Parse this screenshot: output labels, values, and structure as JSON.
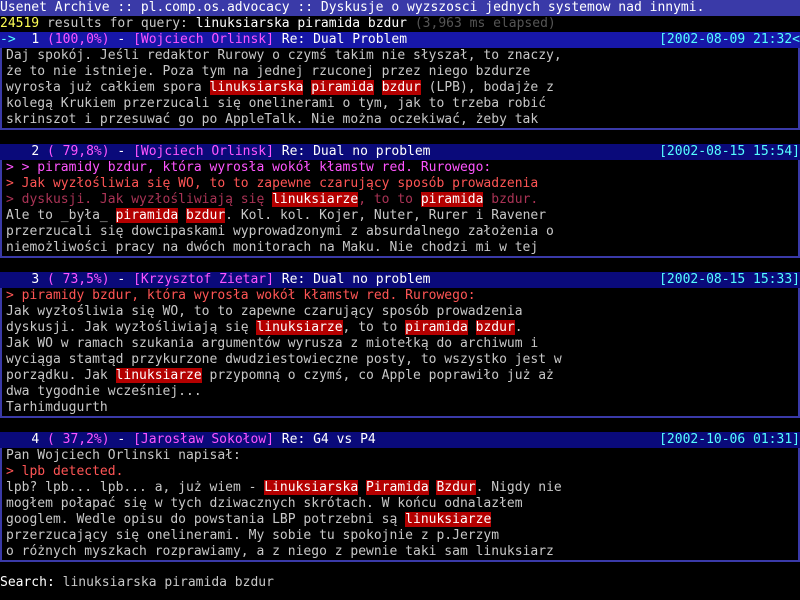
{
  "title": "Usenet Archive :: pl.comp.os.advocacy :: Dyskusje o wyzszosci jednych systemow nad innymi.",
  "status": {
    "count": "24519",
    "text": " results for query: ",
    "query": "linuksiarska piramida bzdur",
    "elapsed": " (3,963 ms elapsed)"
  },
  "results": [
    {
      "marker": "->",
      "num": "1",
      "pct": "(100,0%)",
      "author": "[Wojciech Orlinsk]",
      "subject": "Re: Dual Problem",
      "date": "[2002-08-09 21:32<",
      "lines": [
        [
          {
            "t": "Daj spokój. Jeśli redaktor Rurowy o czymś takim nie słyszał, to znaczy,"
          }
        ],
        [
          {
            "t": "że to nie istnieje. Poza tym na jednej rzuconej przez niego bzdurze"
          }
        ],
        [
          {
            "t": "wyrosła już całkiem spora "
          },
          {
            "t": "linuksiarska",
            "h": 1
          },
          {
            "t": " "
          },
          {
            "t": "piramida",
            "h": 1
          },
          {
            "t": " "
          },
          {
            "t": "bzdur",
            "h": 1
          },
          {
            "t": " (LPB), bodajże z"
          }
        ],
        [
          {
            "t": "kolegą Krukiem przerzucali się onelinerami o tym, jak to trzeba robić"
          }
        ],
        [
          {
            "t": "skrinszot i przesuwać go po AppleTalk. Nie można oczekiwać, żeby tak"
          }
        ]
      ]
    },
    {
      "marker": "  ",
      "num": "2",
      "pct": "( 79,8%)",
      "author": "[Wojciech Orlinsk]",
      "subject": "Re: Dual no problem",
      "date": "[2002-08-15 15:54]",
      "lines": [
        [
          {
            "t": "> > piramidy bzdur, która wyrosła wokół kłamstw red. Rurowego:",
            "c": "quote2"
          }
        ],
        [
          {
            "t": "> Jak wyzłośliwia się WO, to to zapewne czarujący sposób prowadzenia",
            "c": "quote"
          }
        ],
        [
          {
            "t": "> dyskusji. Jak wyzłośliwiają się ",
            "c": "quote3"
          },
          {
            "t": "linuksiarze",
            "h": 1
          },
          {
            "t": ", to to ",
            "c": "quote3"
          },
          {
            "t": "piramida",
            "h": 1
          },
          {
            "t": " bzdur.",
            "c": "quote3"
          }
        ],
        [
          {
            "t": "Ale to _była_ "
          },
          {
            "t": "piramida",
            "h": 1
          },
          {
            "t": " "
          },
          {
            "t": "bzdur",
            "h": 1
          },
          {
            "t": ". Kol. kol. Kojer, Nuter, Rurer i Ravener"
          }
        ],
        [
          {
            "t": "przerzucali się dowcipaskami wyprowadzonymi z absurdalnego założenia o"
          }
        ],
        [
          {
            "t": "niemożliwości pracy na dwóch monitorach na Maku. Nie chodzi mi w tej"
          }
        ]
      ]
    },
    {
      "marker": "  ",
      "num": "3",
      "pct": "( 73,5%)",
      "author": "[Krzysztof Zietar]",
      "subject": "Re: Dual no problem",
      "date": "[2002-08-15 15:33]",
      "lines": [
        [
          {
            "t": "> piramidy bzdur, która wyrosła wokół kłamstw red. Rurowego:",
            "c": "quote"
          }
        ],
        [
          {
            "t": "Jak wyzłośliwia się WO, to to zapewne czarujący sposób prowadzenia"
          }
        ],
        [
          {
            "t": "dyskusji. Jak wyzłośliwiają się "
          },
          {
            "t": "linuksiarze",
            "h": 1
          },
          {
            "t": ", to to "
          },
          {
            "t": "piramida",
            "h": 1
          },
          {
            "t": " "
          },
          {
            "t": "bzdur",
            "h": 1
          },
          {
            "t": "."
          }
        ],
        [
          {
            "t": "Jak WO w ramach szukania argumentów wyrusza z miotełką do archiwum i"
          }
        ],
        [
          {
            "t": "wyciąga stamtąd przykurzone dwudziestowieczne posty, to wszystko jest w"
          }
        ],
        [
          {
            "t": "porządku. Jak "
          },
          {
            "t": "linuksiarze",
            "h": 1
          },
          {
            "t": " przypomną o czymś, co Apple poprawiło już aż"
          }
        ],
        [
          {
            "t": "dwa tygodnie wcześniej..."
          }
        ],
        [
          {
            "t": "Tarhimdugurth"
          }
        ]
      ]
    },
    {
      "marker": "  ",
      "num": "4",
      "pct": "( 37,2%)",
      "author": "[Jarosław Sokołow]",
      "subject": "Re: G4 vs P4",
      "date": "[2002-10-06 01:31]",
      "lines": [
        [
          {
            "t": "Pan Wojciech Orlinski napisał:"
          }
        ],
        [
          {
            "t": "> lpb detected.",
            "c": "quote"
          }
        ],
        [
          {
            "t": "lpb? lpb... lpb... a, już wiem - "
          },
          {
            "t": "Linuksiarska",
            "h": 1
          },
          {
            "t": " "
          },
          {
            "t": "Piramida",
            "h": 1
          },
          {
            "t": " "
          },
          {
            "t": "Bzdur",
            "h": 1
          },
          {
            "t": ". Nigdy nie"
          }
        ],
        [
          {
            "t": "mogłem połapać się w tych dziwacznych skrótach. W końcu odnalazłem"
          }
        ],
        [
          {
            "t": "googlem. Wedle opisu do powstania LBP potrzebni są "
          },
          {
            "t": "linuksiarze",
            "h": 1
          }
        ],
        [
          {
            "t": "przerzucający się onelinerami. My sobie tu spokojnie z p.Jerzym"
          }
        ],
        [
          {
            "t": "o różnych myszkach rozprawiamy, a z niego z pewnie taki sam linuksiarz"
          }
        ]
      ]
    }
  ],
  "search": {
    "label": "Search: ",
    "value": "linuksiarska piramida bzdur"
  }
}
